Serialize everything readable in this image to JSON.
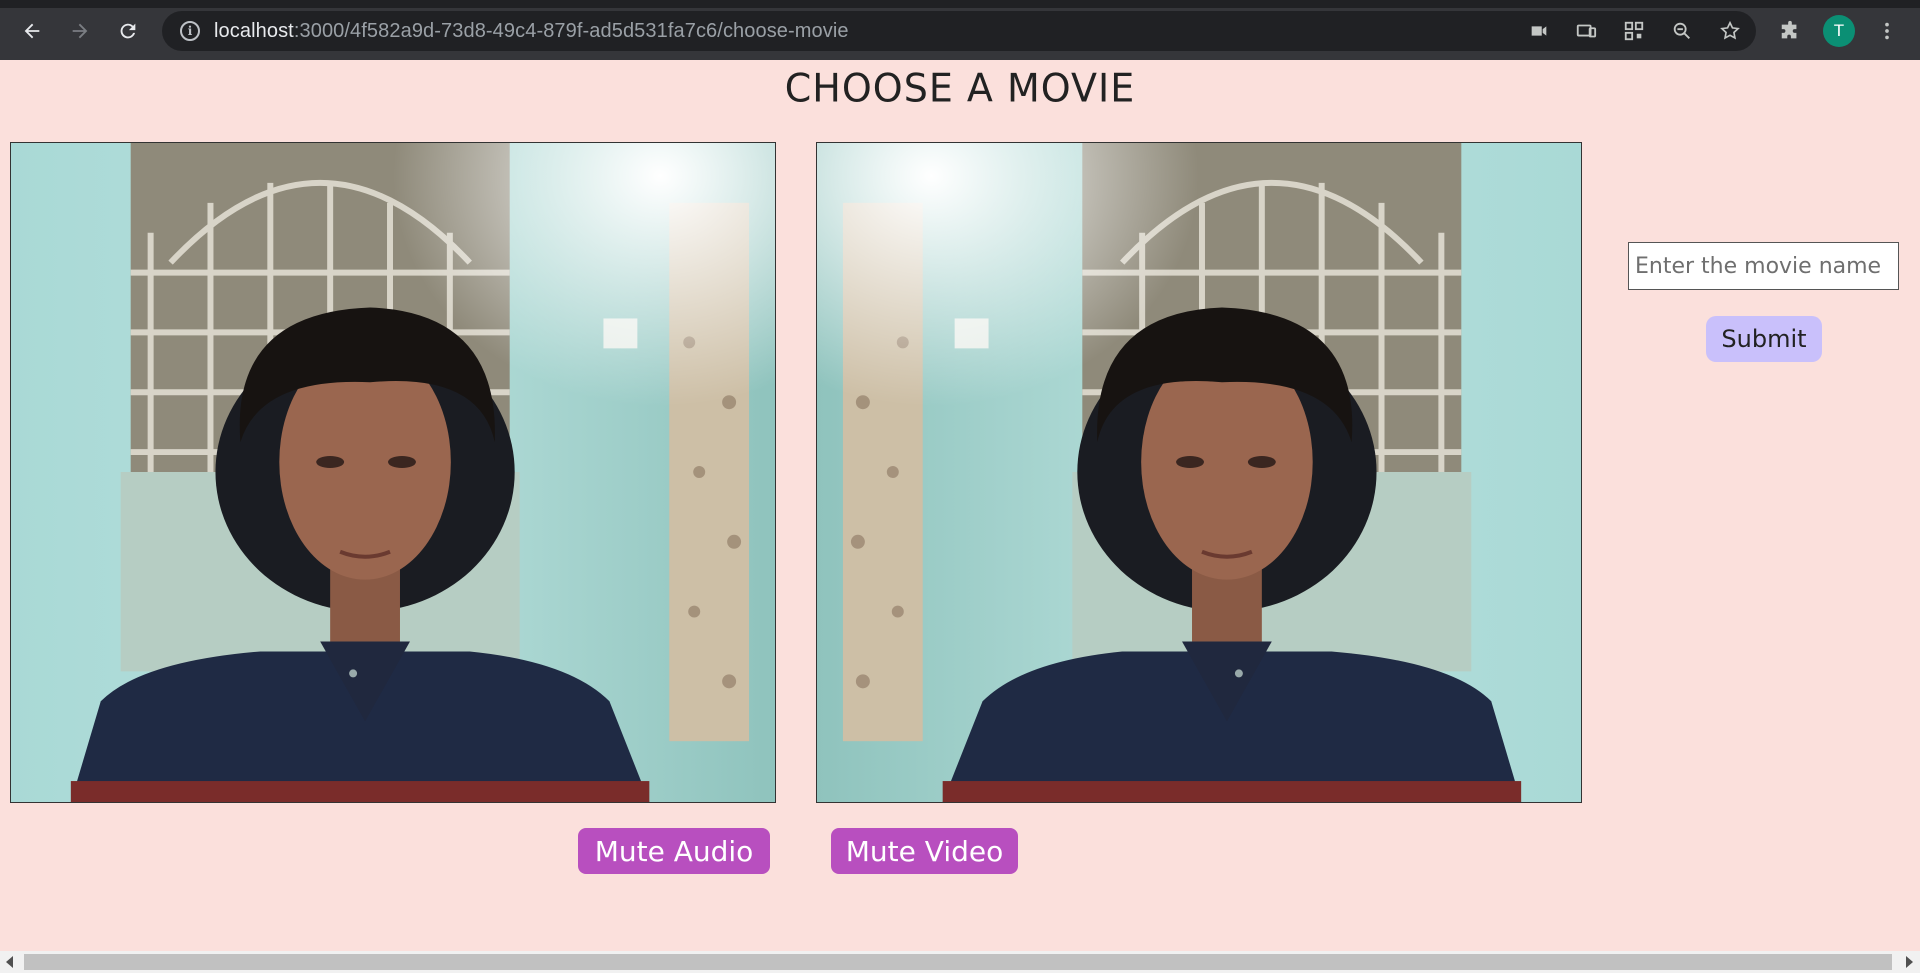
{
  "browser": {
    "url_host": "localhost",
    "url_path": ":3000/4f582a9d-73d8-49c4-879f-ad5d531fa7c6/choose-movie",
    "avatar_initial": "T",
    "icons": [
      "back-icon",
      "forward-icon",
      "reload-icon",
      "info-icon",
      "camera-icon",
      "cast-icon",
      "qr-code-icon",
      "zoom-icon",
      "bookmark-star-icon",
      "extensions-icon",
      "menu-icon"
    ]
  },
  "page": {
    "title": "CHOOSE A MOVIE",
    "movie_input_placeholder": "Enter the movie name",
    "submit_label": "Submit",
    "mute_audio_label": "Mute Audio",
    "mute_video_label": "Mute Video"
  },
  "colors": {
    "background": "#fbe0dc",
    "submit": "#c9c0fb",
    "mute_buttons": "#b84fbf"
  }
}
